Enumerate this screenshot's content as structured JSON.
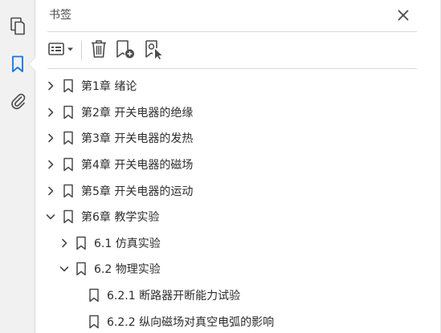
{
  "panel": {
    "title": "书签"
  },
  "rail": {
    "items": [
      {
        "icon": "pages-icon"
      },
      {
        "icon": "bookmark-icon",
        "active": true
      },
      {
        "icon": "attachment-icon"
      }
    ]
  },
  "toolbar": {
    "buttons": [
      {
        "icon": "options-menu-icon"
      },
      {
        "icon": "delete-icon"
      },
      {
        "icon": "new-bookmark-icon"
      },
      {
        "icon": "bookmark-from-selection-icon"
      }
    ]
  },
  "bookmarks": [
    {
      "label": "第1章 绪论",
      "level": 0,
      "state": "collapsed"
    },
    {
      "label": "第2章 开关电器的绝缘",
      "level": 0,
      "state": "collapsed"
    },
    {
      "label": "第3章 开关电器的发热",
      "level": 0,
      "state": "collapsed"
    },
    {
      "label": "第4章 开关电器的磁场",
      "level": 0,
      "state": "collapsed"
    },
    {
      "label": "第5章 开关电器的运动",
      "level": 0,
      "state": "collapsed"
    },
    {
      "label": "第6章 教学实验",
      "level": 0,
      "state": "expanded"
    },
    {
      "label": "6.1 仿真实验",
      "level": 1,
      "state": "collapsed"
    },
    {
      "label": "6.2 物理实验",
      "level": 1,
      "state": "expanded"
    },
    {
      "label": "6.2.1 断路器开断能力试验",
      "level": 2,
      "state": "leaf"
    },
    {
      "label": "6.2.2 纵向磁场对真空电弧的影响",
      "level": 2,
      "state": "leaf"
    }
  ],
  "colors": {
    "accent": "#1473e6",
    "icon": "#4b4b4b"
  }
}
